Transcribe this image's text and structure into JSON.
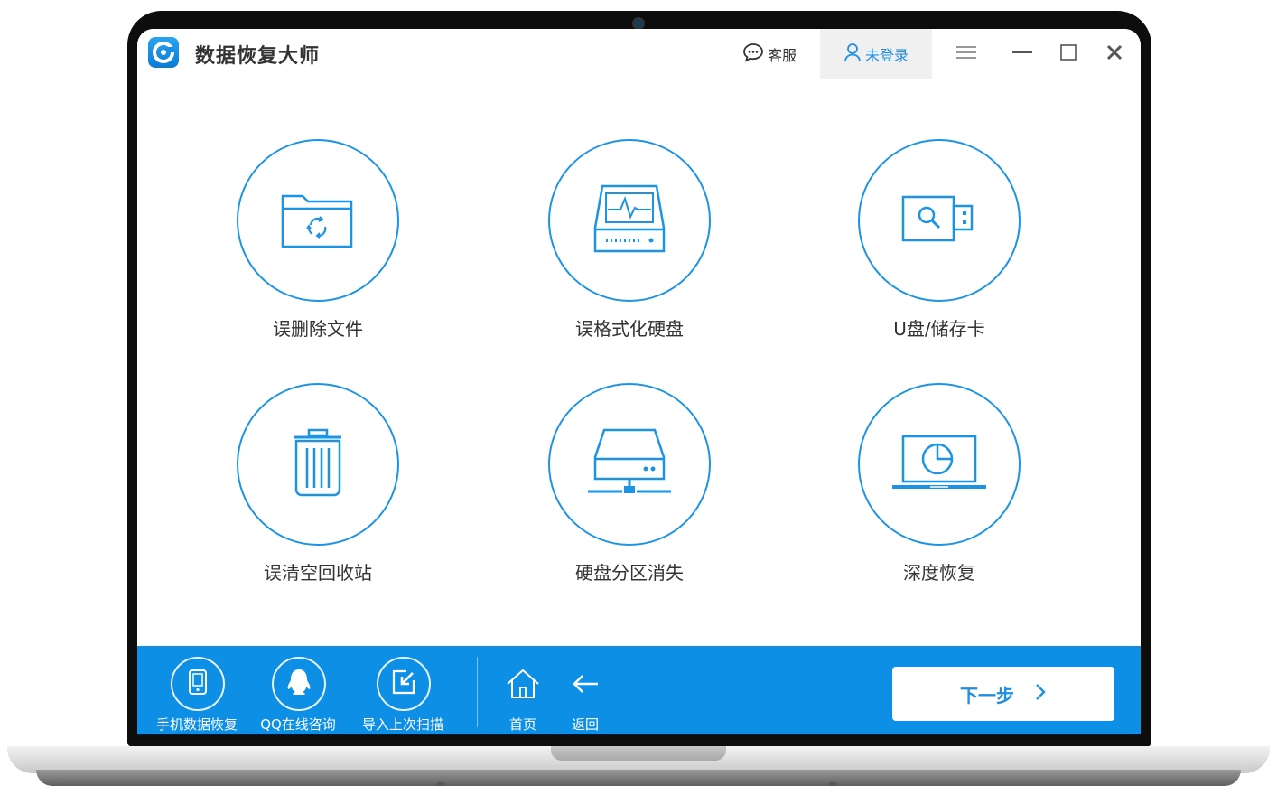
{
  "app": {
    "title": "数据恢复大师"
  },
  "titlebar": {
    "service_label": "客服",
    "login_label": "未登录",
    "menu_icon": "hamburger-icon",
    "minimize_icon": "minimize-icon",
    "maximize_icon": "maximize-icon",
    "close_icon": "close-icon"
  },
  "modes": [
    {
      "label": "误删除文件",
      "icon": "folder-recycle-icon"
    },
    {
      "label": "误格式化硬盘",
      "icon": "hard-disk-pulse-icon"
    },
    {
      "label": "U盘/储存卡",
      "icon": "usb-drive-icon"
    },
    {
      "label": "误清空回收站",
      "icon": "trash-bin-icon"
    },
    {
      "label": "硬盘分区消失",
      "icon": "network-drive-icon"
    },
    {
      "label": "深度恢复",
      "icon": "laptop-scan-icon"
    }
  ],
  "bottombar": {
    "tools": [
      {
        "label": "手机数据恢复",
        "icon": "phone-icon"
      },
      {
        "label": "QQ在线咨询",
        "icon": "qq-penguin-icon"
      },
      {
        "label": "导入上次扫描",
        "icon": "import-icon"
      }
    ],
    "home_label": "首页",
    "back_label": "返回",
    "next_label": "下一步"
  },
  "colors": {
    "accent": "#1d93e3",
    "bottom_bar": "#0e8fe6",
    "text": "#333333"
  }
}
